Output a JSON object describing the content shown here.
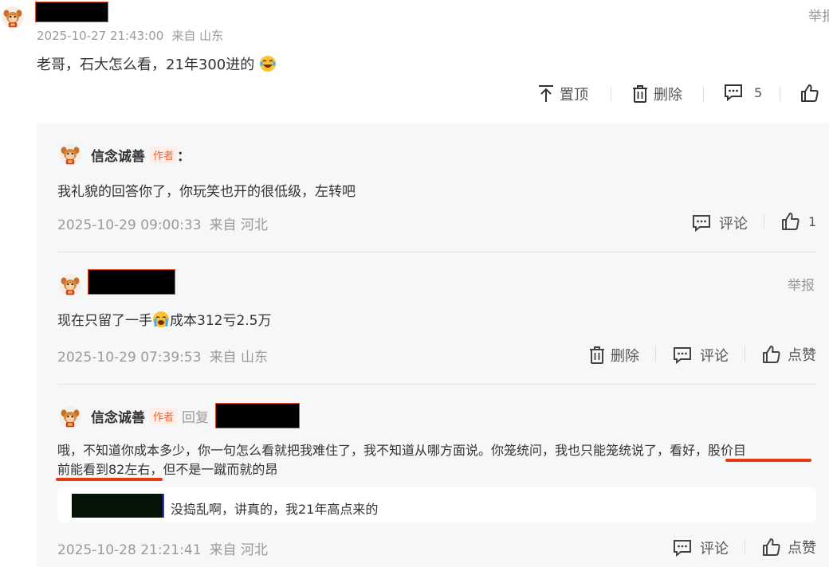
{
  "top_comment": {
    "timestamp": "2025-10-27 21:43:00",
    "location": "来自 山东",
    "text_before_emoji": "老哥，石大怎么看，21年300进的",
    "emoji": "laughing-crying-emoji",
    "report": "举报",
    "actions": {
      "pin": "置顶",
      "delete": "删除",
      "comment_count": "5"
    }
  },
  "replies": [
    {
      "username": "信念诚善",
      "author_tag": "作者",
      "colon": "：",
      "text": "我礼貌的回答你了，你玩笑也开的很低级，左转吧",
      "timestamp": "2025-10-29 09:00:33",
      "location": "来自 河北",
      "comment_label": "评论",
      "like_count": "1"
    },
    {
      "report": "举报",
      "text_before_emoji": "现在只留了一手",
      "text_after_emoji": "成本312亏2.5万",
      "emoji": "crying-emoji",
      "timestamp": "2025-10-29 07:39:53",
      "location": "来自 山东",
      "delete_label": "删除",
      "comment_label": "评论",
      "like_label": "点赞"
    },
    {
      "username": "信念诚善",
      "author_tag": "作者",
      "reply_word": "回复",
      "text_line1": "哦，不知道你成本多少，你一句怎么看就把我难住了，我不知道从哪方面说。你笼统问，我也只能笼统说了，看好，股价目",
      "text_line2": "前能看到82左右，但不是一蹴而就的昂",
      "quoted_text": "没捣乱啊，讲真的，我21年高点来的",
      "timestamp": "2025-10-28 21:21:41",
      "location": "来自 河北",
      "comment_label": "评论",
      "like_label": "点赞"
    }
  ],
  "colors": {
    "accent_orange": "#f2622e",
    "underline_red": "#e83a10",
    "panel_bg": "#f6f7f9",
    "meta_gray": "#9a9a9a"
  }
}
